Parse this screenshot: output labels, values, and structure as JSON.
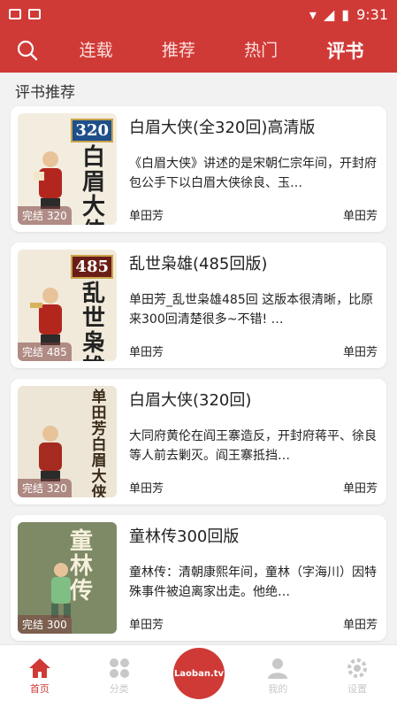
{
  "statusbar": {
    "time": "9:31"
  },
  "nav": {
    "tabs": [
      "连载",
      "推荐",
      "热门",
      "评书"
    ],
    "active": "评书"
  },
  "section": {
    "title": "评书推荐"
  },
  "items": [
    {
      "title": "白眉大侠(全320回)高清版",
      "desc": "《白眉大侠》讲述的是宋朝仁宗年间，开封府包公手下以白眉大侠徐良、玉…",
      "author": "单田芳",
      "anchor": "单田芳",
      "badge": "完结 320",
      "cover_num": "320",
      "cover_text": "白眉大侠",
      "cover_bg": "#f3ede0"
    },
    {
      "title": "乱世枭雄(485回版)",
      "desc": "单田芳_乱世枭雄485回  这版本很清晰，比原来300回清楚很多~不错!  …",
      "author": "单田芳",
      "anchor": "单田芳",
      "badge": "完结 485",
      "cover_num": "485",
      "cover_text": "乱世枭雄",
      "cover_bg": "#f1eadb"
    },
    {
      "title": "白眉大侠(320回)",
      "desc": "大同府黄伦在阎王寨造反，开封府蒋平、徐良等人前去剿灭。阎王寨抵挡…",
      "author": "单田芳",
      "anchor": "单田芳",
      "badge": "完结 320",
      "cover_num": "",
      "cover_text": "单田芳白眉大侠",
      "cover_bg": "#ede6d6"
    },
    {
      "title": "童林传300回版",
      "desc": "童林传：清朝康熙年间，童林（字海川）因特殊事件被迫离家出走。他绝…",
      "author": "单田芳",
      "anchor": "单田芳",
      "badge": "完结 300",
      "cover_num": "",
      "cover_text": "童林传",
      "cover_bg": "#7e8a66"
    }
  ],
  "bottom": {
    "items": [
      "首页",
      "分类",
      "我的",
      "设置"
    ],
    "logo": "Laoban.tv"
  },
  "colors": {
    "primary": "#d03a36"
  }
}
